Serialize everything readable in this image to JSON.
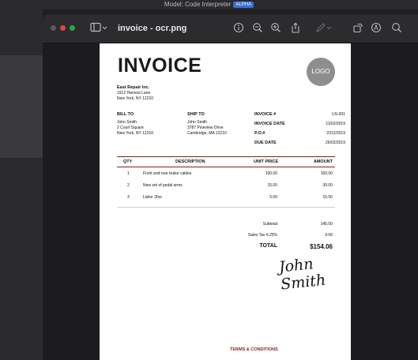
{
  "menubar": {
    "title": "Model: Code Interpreter",
    "badge": "ALPHA"
  },
  "window": {
    "title": "invoice - ocr.png"
  },
  "invoice": {
    "title": "INVOICE",
    "logo": "LOGO",
    "company": [
      "East Repair Inc.",
      "1912 Harvest Lane",
      "New York, NY 12210"
    ],
    "bill_to": {
      "label": "BILL TO",
      "lines": [
        "John Smith",
        "2 Court Square",
        "New York, NY 12210"
      ]
    },
    "ship_to": {
      "label": "SHIP TO",
      "lines": [
        "John Smith",
        "3787 Pineview Drive",
        "Cambridge, MA 12210"
      ]
    },
    "meta": [
      {
        "label": "INVOICE #",
        "value": "US-001"
      },
      {
        "label": "INVOICE DATE",
        "value": "11/02/2019"
      },
      {
        "label": "P.O.#",
        "value": "2312/2019"
      },
      {
        "label": "DUE DATE",
        "value": "26/02/2019"
      }
    ],
    "columns": [
      "QTY",
      "DESCRIPTION",
      "UNIT PRICE",
      "AMOUNT"
    ],
    "rows": [
      {
        "qty": "1",
        "desc": "Front and rear brake cables",
        "price": "100.00",
        "amount": "100.00"
      },
      {
        "qty": "2",
        "desc": "New set of pedal arms",
        "price": "15.00",
        "amount": "30.00"
      },
      {
        "qty": "3",
        "desc": "Labor 3hrs",
        "price": "5.00",
        "amount": "15.00"
      }
    ],
    "subtotal": {
      "label": "Subtotal",
      "value": "145.00"
    },
    "tax": {
      "label": "Sales Tax 6.25%",
      "value": "9.06"
    },
    "total": {
      "label": "TOTAL",
      "value": "$154.06"
    },
    "signature": "John Smith",
    "terms": "TERMS & CONDITIONS"
  }
}
